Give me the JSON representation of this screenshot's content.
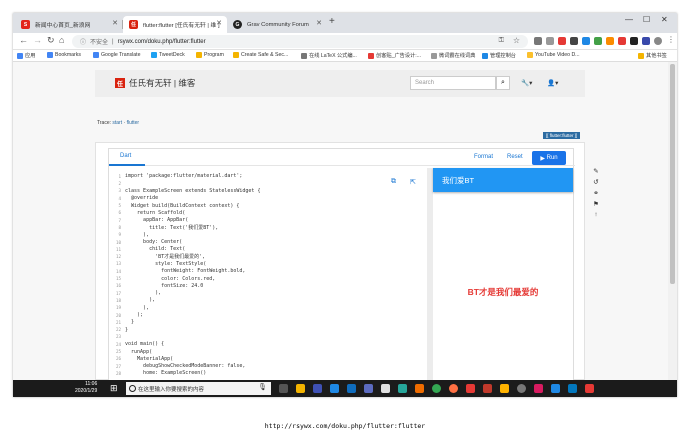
{
  "browser": {
    "tabs": [
      {
        "title": "新闻中心首页_新浪网",
        "fav_color": "#e2231a",
        "fav_text": "S"
      },
      {
        "title": "flutter:flutter [任氏有无轩 | 维 ]",
        "fav_color": "#d9230f",
        "fav_text": "任"
      },
      {
        "title": "Grav Community Forum",
        "fav_color": "#222222",
        "fav_text": "G"
      }
    ],
    "new_tab": "+",
    "security_label": "不安全",
    "url": "rsywx.com/doku.php/flutter:flutter",
    "bookmarks": [
      "应用",
      "Bookmarks",
      "Google Translate",
      "TweetDeck",
      "Program",
      "Create Safe & Sec...",
      "在线 LaTeX 公式编...",
      "创客贴_广告设计:...",
      "微词霸在线词典",
      "管理控制台",
      "YouTube Video D...",
      "其他书签"
    ]
  },
  "site": {
    "logo_text": "任",
    "name": "任氏有无轩 | 维客",
    "search_placeholder": "Search",
    "trace_label": "Trace",
    "trace_links": [
      "start",
      "flutter"
    ],
    "page_tag": "[[ flutter:flutter ]]"
  },
  "dartpad": {
    "tab": "Dart",
    "format": "Format",
    "reset": "Reset",
    "run": "Run",
    "code": [
      "import 'package:flutter/material.dart';",
      "",
      "class ExampleScreen extends StatelessWidget {",
      "  @override",
      "  Widget build(BuildContext context) {",
      "    return Scaffold(",
      "      appBar: AppBar(",
      "        title: Text('我们爱BT'),",
      "      ),",
      "      body: Center(",
      "        child: Text(",
      "          'BT才是我们最爱的',",
      "          style: TextStyle(",
      "            fontWeight: FontWeight.bold,",
      "            color: Colors.red,",
      "            fontSize: 24.0",
      "          ),",
      "        ),",
      "      ),",
      "    );",
      "  }",
      "}",
      "",
      "void main() {",
      "  runApp(",
      "    MaterialApp(",
      "      debugShowCheckedModeBanner: false,",
      "      home: ExampleScreen()"
    ],
    "preview_appbar_title": "我们爱BT",
    "preview_body_text": "BT才是我们最爱的"
  },
  "taskbar": {
    "time": "11:06",
    "date": "2020/1/29",
    "search_placeholder": "在这里输入你要搜索的内容"
  },
  "caption": "http://rsywx.com/doku.php/flutter:flutter"
}
